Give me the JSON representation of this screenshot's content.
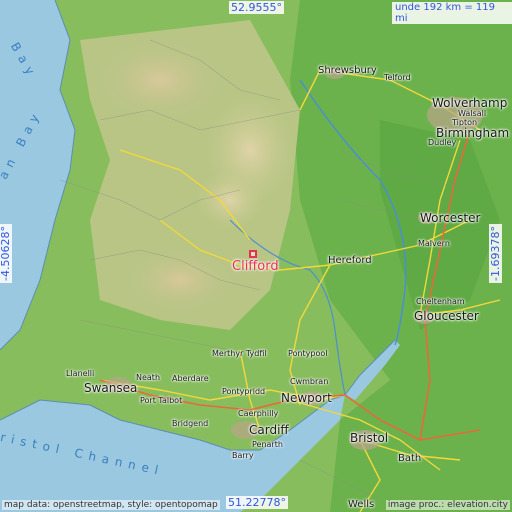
{
  "map": {
    "marker_label": "Clifford",
    "coords": {
      "top": "52.9555°",
      "bottom": "51.22778°",
      "left": "-4.50628°",
      "right": "-1.69378°"
    },
    "scale": {
      "prefix": "unde",
      "value": "192 km = 119 mi"
    },
    "credit_left": "map data: openstreetmap, style: opentopomap",
    "credit_right": "image proc.: elevation.city",
    "sea_labels": {
      "bay_a": "Bay",
      "bay_b": "an Bay",
      "channel": "ristol Channel"
    },
    "places": [
      {
        "id": "shrewsbury",
        "name": "Shrewsbury",
        "size": "med"
      },
      {
        "id": "telford",
        "name": "Telford",
        "size": "med"
      },
      {
        "id": "wolverhampton",
        "name": "Wolverhamp",
        "size": "big"
      },
      {
        "id": "walsall",
        "name": "Walsall",
        "size": "sm"
      },
      {
        "id": "tipton",
        "name": "Tipton",
        "size": "sm"
      },
      {
        "id": "birmingham",
        "name": "Birmingham",
        "size": "big"
      },
      {
        "id": "dudley",
        "name": "Dudley",
        "size": "sm"
      },
      {
        "id": "worcester",
        "name": "Worcester",
        "size": "big"
      },
      {
        "id": "malvern",
        "name": "Malvern",
        "size": "sm"
      },
      {
        "id": "hereford",
        "name": "Hereford",
        "size": "med"
      },
      {
        "id": "cheltenham",
        "name": "Cheltenham",
        "size": "sm"
      },
      {
        "id": "gloucester",
        "name": "Gloucester",
        "size": "big"
      },
      {
        "id": "merthyr",
        "name": "Merthyr Tydfil",
        "size": "sm"
      },
      {
        "id": "pontypool",
        "name": "Pontypool",
        "size": "sm"
      },
      {
        "id": "cwmbran",
        "name": "Cwmbran",
        "size": "sm"
      },
      {
        "id": "neath",
        "name": "Neath",
        "size": "sm"
      },
      {
        "id": "aberdare",
        "name": "Aberdare",
        "size": "sm"
      },
      {
        "id": "llanelli",
        "name": "Llanelli",
        "size": "sm"
      },
      {
        "id": "swansea",
        "name": "Swansea",
        "size": "big"
      },
      {
        "id": "porttalbot",
        "name": "Port Talbot",
        "size": "sm"
      },
      {
        "id": "pontypridd",
        "name": "Pontypridd",
        "size": "sm"
      },
      {
        "id": "newport",
        "name": "Newport",
        "size": "big"
      },
      {
        "id": "caerphilly",
        "name": "Caerphilly",
        "size": "sm"
      },
      {
        "id": "bridgend",
        "name": "Bridgend",
        "size": "sm"
      },
      {
        "id": "cardiff",
        "name": "Cardiff",
        "size": "big"
      },
      {
        "id": "penarth",
        "name": "Penarth",
        "size": "sm"
      },
      {
        "id": "barry",
        "name": "Barry",
        "size": "sm"
      },
      {
        "id": "bristol",
        "name": "Bristol",
        "size": "big"
      },
      {
        "id": "bath",
        "name": "Bath",
        "size": "med"
      },
      {
        "id": "wells",
        "name": "Wells",
        "size": "med"
      }
    ]
  }
}
